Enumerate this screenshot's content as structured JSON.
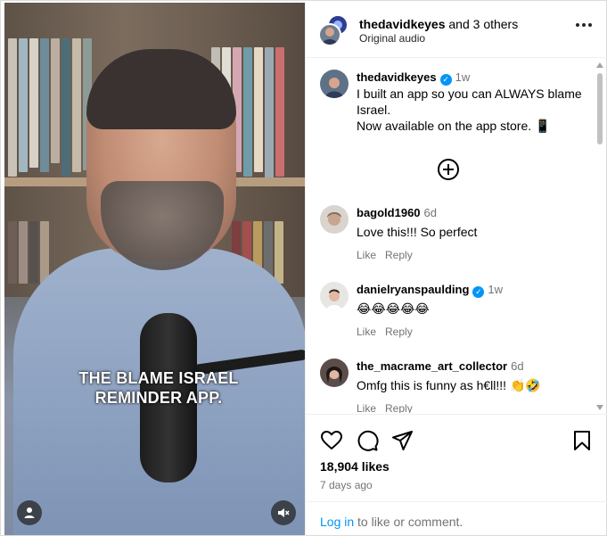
{
  "video": {
    "caption_line1": "THE BLAME ISRAEL",
    "caption_line2": "REMINDER APP."
  },
  "header": {
    "author": "thedavidkeyes",
    "collab_suffix": " and 3 others",
    "audio": "Original audio"
  },
  "post": {
    "author": "thedavidkeyes",
    "verified": true,
    "time": "1w",
    "caption_line1": "I built an app so you can ALWAYS blame",
    "caption_line2": "Israel.",
    "caption_line3": "Now available on the app store. 📱"
  },
  "comments": [
    {
      "user": "bagold1960",
      "verified": false,
      "time": "6d",
      "text": "Love this!!! So perfect",
      "like_label": "Like",
      "reply_label": "Reply"
    },
    {
      "user": "danielryanspaulding",
      "verified": true,
      "time": "1w",
      "text": "😂😂😂😂😂",
      "like_label": "Like",
      "reply_label": "Reply"
    },
    {
      "user": "the_macrame_art_collector",
      "verified": false,
      "time": "6d",
      "text": "Omfg this is funny as h€ll!!! 👏🤣",
      "like_label": "Like",
      "reply_label": "Reply"
    }
  ],
  "footer": {
    "likes": "18,904 likes",
    "date": "7 days ago",
    "login_link": "Log in",
    "login_rest": " to like or comment."
  },
  "colors": {
    "accent": "#0095f6",
    "muted": "#737373",
    "border": "#efefef"
  },
  "icons": [
    "more-icon",
    "verified-icon",
    "load-more-icon",
    "heart-icon",
    "comment-icon",
    "share-icon",
    "bookmark-icon",
    "profile-icon",
    "mute-icon"
  ]
}
